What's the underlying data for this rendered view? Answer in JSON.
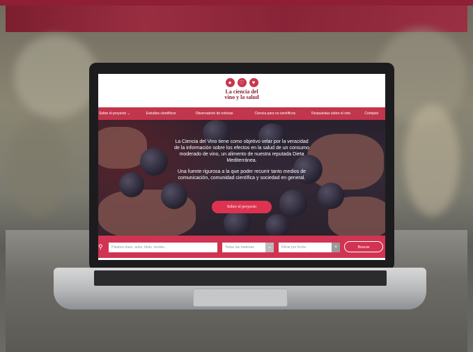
{
  "site": {
    "logo_icons": [
      "grapes-icon",
      "wine-glass-icon",
      "heart-icon"
    ],
    "brand_line1": "La ciencia del",
    "brand_line2": "vino y la salud"
  },
  "nav": [
    {
      "label": "Sobre el proyecto ⌄"
    },
    {
      "label": "Estudios científicos"
    },
    {
      "label": "Observatorio de noticias"
    },
    {
      "label": "Ciencia para no científicos"
    },
    {
      "label": "Respuestas sobre el vino"
    },
    {
      "label": "Contacto"
    }
  ],
  "hero": {
    "paragraph1": "La Ciencia del Vino tiene como objetivo velar por la veracidad de la información sobre los efectos en la salud de un consumo moderado de vino, un alimento de nuestra reputada Dieta Mediterránea.",
    "paragraph2": "Una fuente rigurosa a la que poder recurrir tanto medios de comunicación, comunidad científica y sociedad en general.",
    "cta_label": "Sobre el proyecto"
  },
  "search": {
    "keyword_placeholder": "Palabra clave, autor, título, revista...",
    "subject_selected": "Todas las materias",
    "date_placeholder": "Filtrar por fecha",
    "button_label": "Buscar"
  },
  "colors": {
    "brand_red": "#c1364c",
    "search_red": "#d13352",
    "dark_red": "#8b1c30"
  }
}
